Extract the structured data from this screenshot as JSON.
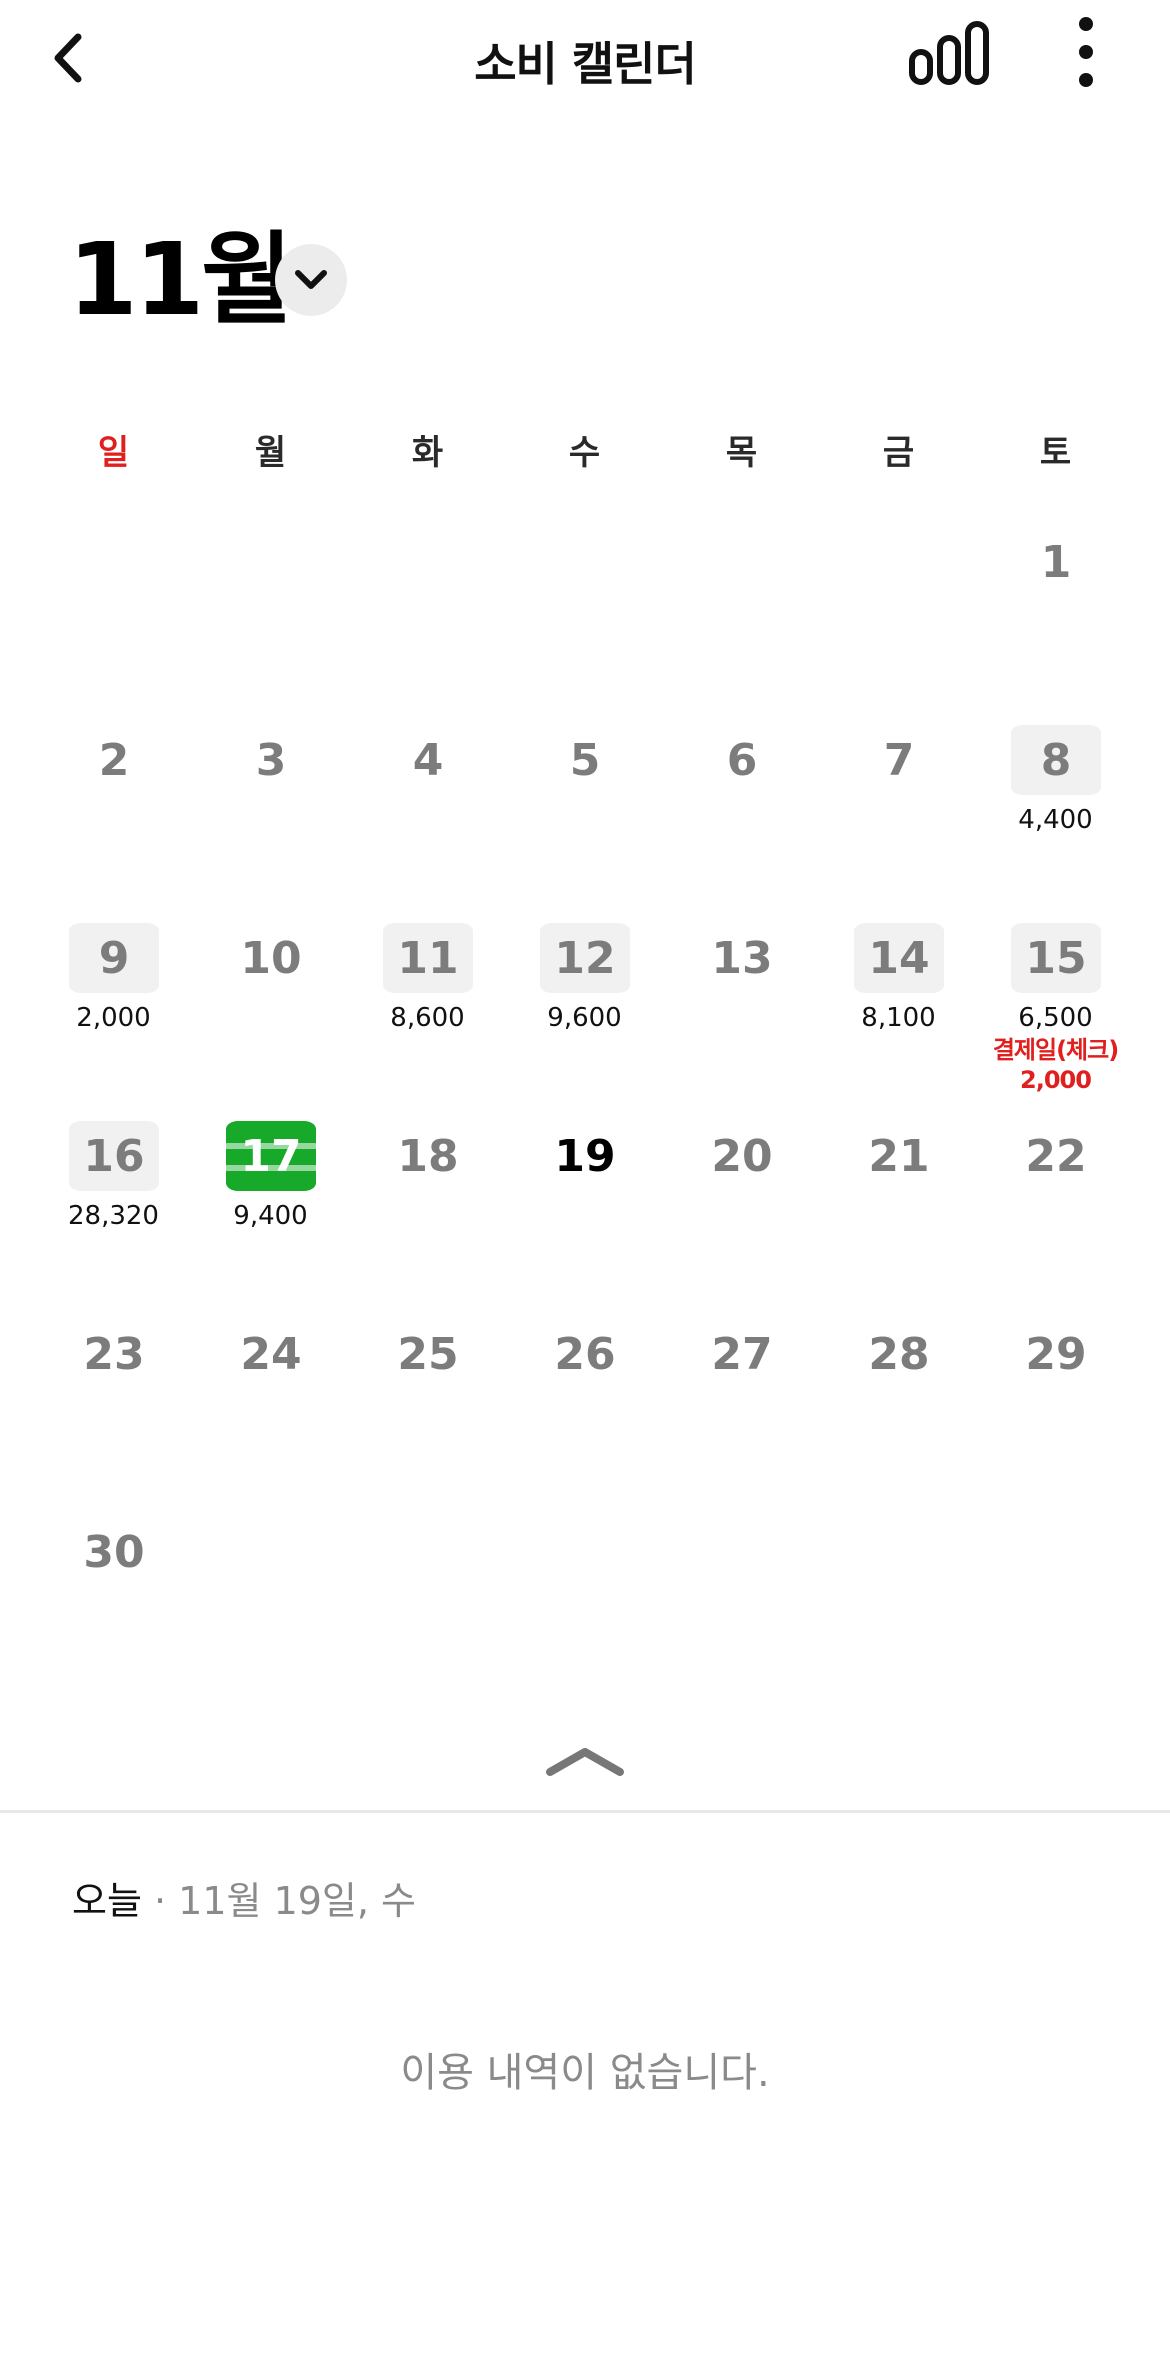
{
  "header": {
    "title": "소비 캘린더",
    "icons": {
      "back": "chevron-left-icon",
      "stats": "bar-chart-icon",
      "more": "more-vertical-icon"
    }
  },
  "month": {
    "label": "11월",
    "dropdown_icon": "chevron-down-icon"
  },
  "weekdays": [
    "일",
    "월",
    "화",
    "수",
    "목",
    "금",
    "토"
  ],
  "days": [
    {
      "d": "1",
      "col": 6,
      "row": 0
    },
    {
      "d": "2",
      "col": 0,
      "row": 1
    },
    {
      "d": "3",
      "col": 1,
      "row": 1
    },
    {
      "d": "4",
      "col": 2,
      "row": 1
    },
    {
      "d": "5",
      "col": 3,
      "row": 1
    },
    {
      "d": "6",
      "col": 4,
      "row": 1
    },
    {
      "d": "7",
      "col": 5,
      "row": 1
    },
    {
      "d": "8",
      "col": 6,
      "row": 1,
      "amount": "4,400",
      "has_spending": true
    },
    {
      "d": "9",
      "col": 0,
      "row": 2,
      "amount": "2,000",
      "has_spending": true
    },
    {
      "d": "10",
      "col": 1,
      "row": 2
    },
    {
      "d": "11",
      "col": 2,
      "row": 2,
      "amount": "8,600",
      "has_spending": true
    },
    {
      "d": "12",
      "col": 3,
      "row": 2,
      "amount": "9,600",
      "has_spending": true
    },
    {
      "d": "13",
      "col": 4,
      "row": 2
    },
    {
      "d": "14",
      "col": 5,
      "row": 2,
      "amount": "8,100",
      "has_spending": true
    },
    {
      "d": "15",
      "col": 6,
      "row": 2,
      "amount": "6,500",
      "has_spending": true,
      "note_label": "결제일(체크)",
      "note_amount": "2,000"
    },
    {
      "d": "16",
      "col": 0,
      "row": 3,
      "amount": "28,320",
      "has_spending": true
    },
    {
      "d": "17",
      "col": 1,
      "row": 3,
      "amount": "9,400",
      "has_spending": true,
      "selected": true
    },
    {
      "d": "18",
      "col": 2,
      "row": 3
    },
    {
      "d": "19",
      "col": 3,
      "row": 3,
      "today": true
    },
    {
      "d": "20",
      "col": 4,
      "row": 3
    },
    {
      "d": "21",
      "col": 5,
      "row": 3
    },
    {
      "d": "22",
      "col": 6,
      "row": 3
    },
    {
      "d": "23",
      "col": 0,
      "row": 4
    },
    {
      "d": "24",
      "col": 1,
      "row": 4
    },
    {
      "d": "25",
      "col": 2,
      "row": 4
    },
    {
      "d": "26",
      "col": 3,
      "row": 4
    },
    {
      "d": "27",
      "col": 4,
      "row": 4
    },
    {
      "d": "28",
      "col": 5,
      "row": 4
    },
    {
      "d": "29",
      "col": 6,
      "row": 4
    },
    {
      "d": "30",
      "col": 0,
      "row": 5
    }
  ],
  "colors": {
    "sunday": "#e0201e",
    "selected": "#17a92a",
    "note": "#e0201e",
    "muted": "#7c7c7c"
  },
  "collapse_icon": "chevron-up-icon",
  "selected_date": {
    "today_label": "오늘",
    "separator": " · ",
    "date": "11월 19일, 수"
  },
  "empty_message": "이용 내역이 없습니다."
}
